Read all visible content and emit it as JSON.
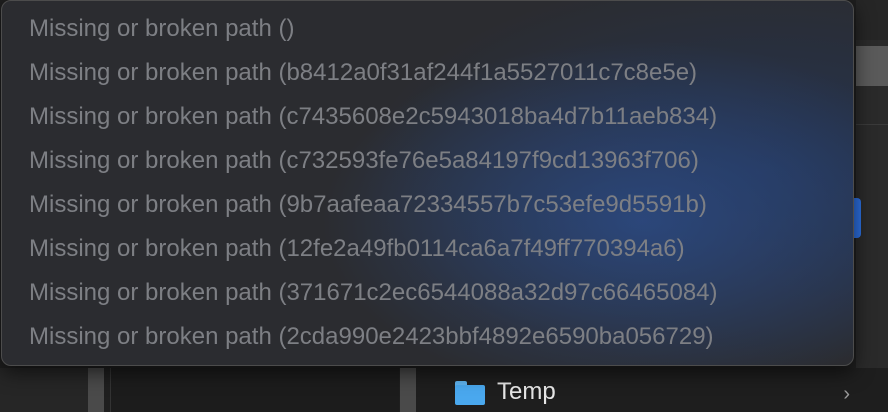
{
  "menu": {
    "items": [
      {
        "label": "Missing or broken path ()"
      },
      {
        "label": "Missing or broken path (b8412a0f31af244f1a5527011c7c8e5e)"
      },
      {
        "label": "Missing or broken path (c7435608e2c5943018ba4d7b11aeb834)"
      },
      {
        "label": "Missing or broken path (c732593fe76e5a84197f9cd13963f706)"
      },
      {
        "label": "Missing or broken path (9b7aafeaa72334557b7c53efe9d5591b)"
      },
      {
        "label": "Missing or broken path (12fe2a49fb0114ca6a7f49ff770394a6)"
      },
      {
        "label": "Missing or broken path (371671c2ec6544088a32d97c66465084)"
      },
      {
        "label": "Missing or broken path (2cda990e2423bbf4892e6590ba056729)"
      }
    ]
  },
  "browser": {
    "folder_label": "Temp",
    "folder_icon": "folder-icon",
    "chevron": "›"
  },
  "colors": {
    "folder": "#4aa8ee",
    "accent": "#2c6fe0"
  }
}
